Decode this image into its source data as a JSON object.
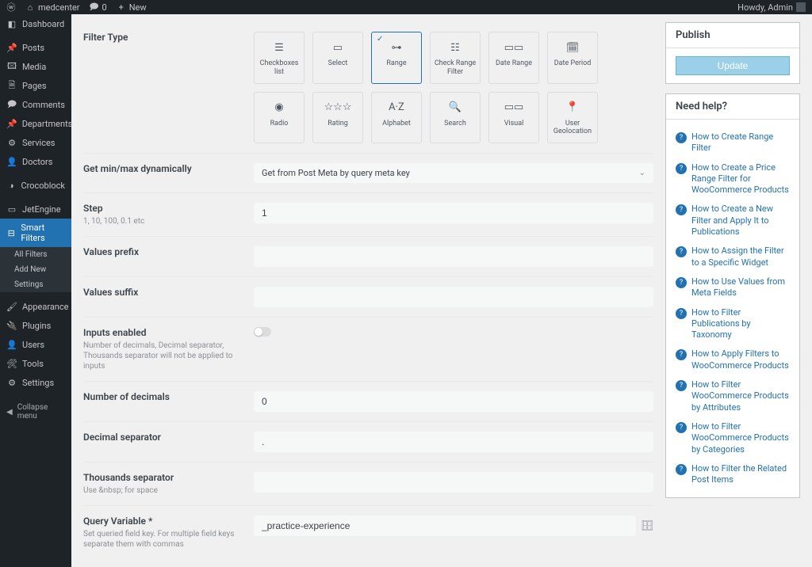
{
  "adminbar": {
    "site_name": "medcenter",
    "comments_count": "0",
    "new_label": "New",
    "howdy": "Howdy, Admin"
  },
  "sidebar": {
    "items": [
      {
        "label": "Dashboard"
      },
      {
        "label": "Posts"
      },
      {
        "label": "Media"
      },
      {
        "label": "Pages"
      },
      {
        "label": "Comments"
      },
      {
        "label": "Departments"
      },
      {
        "label": "Services"
      },
      {
        "label": "Doctors"
      },
      {
        "label": "Crocoblock"
      },
      {
        "label": "JetEngine"
      },
      {
        "label": "Smart Filters"
      }
    ],
    "submenu": [
      {
        "label": "All Filters"
      },
      {
        "label": "Add New"
      },
      {
        "label": "Settings"
      }
    ],
    "items2": [
      {
        "label": "Appearance"
      },
      {
        "label": "Plugins"
      },
      {
        "label": "Users"
      },
      {
        "label": "Tools"
      },
      {
        "label": "Settings"
      }
    ],
    "collapse": "Collapse menu"
  },
  "publish": {
    "title": "Publish",
    "update": "Update"
  },
  "help": {
    "title": "Need help?",
    "links": [
      "How to Create Range Filter",
      "How to Create a Price Range Filter for WooCommerce Products",
      "How to Create a New Filter and Apply It to Publications",
      "How to Assign the Filter to a Specific Widget",
      "How to Use Values from Meta Fields",
      "How to Filter Publications by Taxonomy",
      "How to Apply Filters to WooCommerce Products",
      "How to Filter WooCommerce Products by Attributes",
      "How to Filter WooCommerce Products by Categories",
      "How to Filter the Related Post Items"
    ]
  },
  "filter_types": [
    {
      "label": "Checkboxes list"
    },
    {
      "label": "Select"
    },
    {
      "label": "Range"
    },
    {
      "label": "Check Range Filter"
    },
    {
      "label": "Date Range"
    },
    {
      "label": "Date Period"
    },
    {
      "label": "Radio"
    },
    {
      "label": "Rating"
    },
    {
      "label": "Alphabet"
    },
    {
      "label": "Search"
    },
    {
      "label": "Visual"
    },
    {
      "label": "User Geolocation"
    }
  ],
  "fields": {
    "filter_type": "Filter Type",
    "getminmax_label": "Get min/max dynamically",
    "getminmax_value": "Get from Post Meta by query meta key",
    "step_label": "Step",
    "step_desc": "1, 10, 100, 0.1 etc",
    "step_value": "1",
    "prefix_label": "Values prefix",
    "suffix_label": "Values suffix",
    "inputs_label": "Inputs enabled",
    "inputs_desc": "Number of decimals, Decimal separator, Thousands separator will not be applied to inputs",
    "decimals_label": "Number of decimals",
    "decimals_value": "0",
    "decsep_label": "Decimal separator",
    "decsep_value": ".",
    "thsep_label": "Thousands separator",
    "thsep_desc": "Use &nbsp; for space",
    "query_label": "Query Variable *",
    "query_desc": "Set queried field key. For multiple field keys separate them with commas",
    "query_value": "_practice-experience"
  }
}
